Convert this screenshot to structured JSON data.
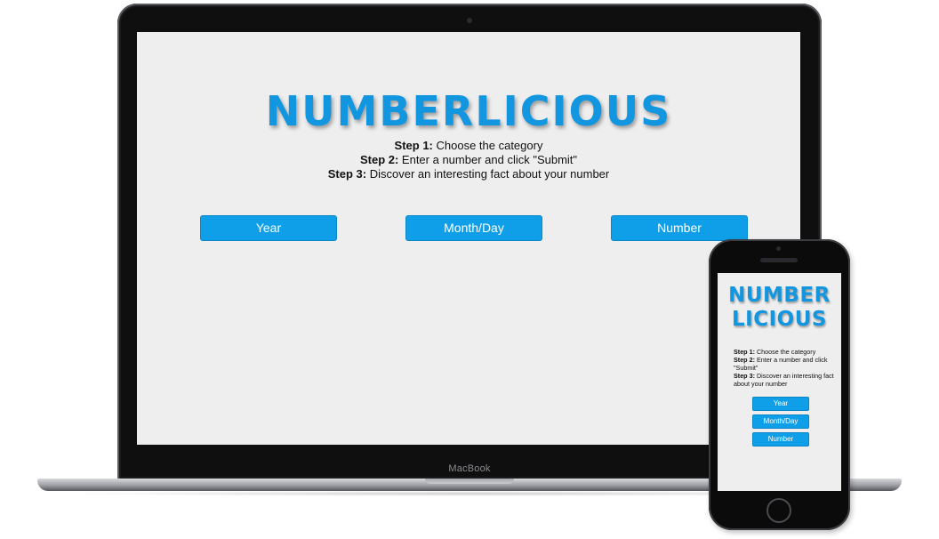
{
  "app": {
    "title": "NUMBERLICIOUS",
    "title_line1": "NUMBER",
    "title_line2": "LICIOUS",
    "accent_color": "#1296df"
  },
  "steps": [
    {
      "label": "Step 1:",
      "text": " Choose the category"
    },
    {
      "label": "Step 2:",
      "text": " Enter a number and click \"Submit\""
    },
    {
      "label": "Step 3:",
      "text": " Discover an interesting fact about your number"
    }
  ],
  "categories": [
    {
      "label": "Year"
    },
    {
      "label": "Month/Day"
    },
    {
      "label": "Number"
    }
  ],
  "devices": {
    "laptop_brand": "MacBook"
  }
}
